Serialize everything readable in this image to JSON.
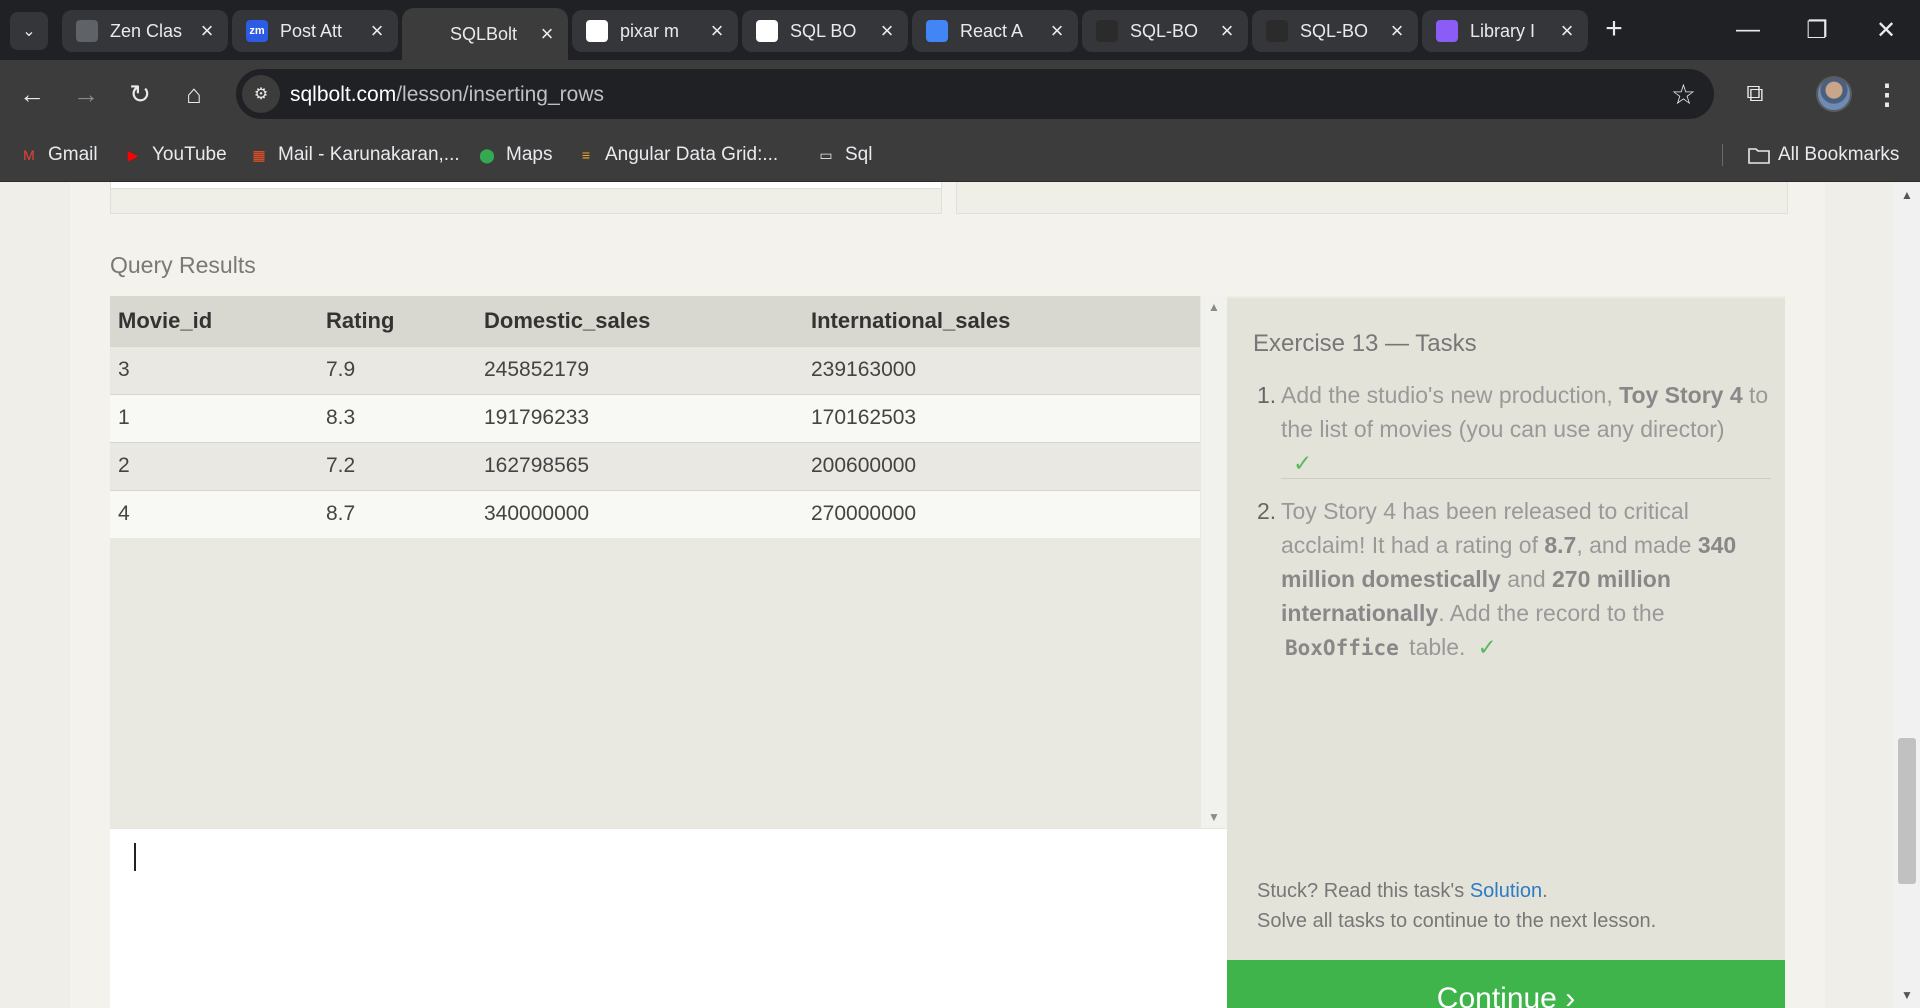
{
  "browser": {
    "tabs": [
      {
        "title": "Zen Clas",
        "icon": "page-icon",
        "icon_color": "#5f6368"
      },
      {
        "title": "Post Att",
        "icon": "zoom-icon",
        "icon_color": "#2d5be3",
        "icon_text": "zm"
      },
      {
        "title": "SQLBolt",
        "icon": "database-icon",
        "icon_color": "#3c3c3c",
        "active": true
      },
      {
        "title": "pixar m",
        "icon": "google-icon",
        "icon_color": "#ffffff"
      },
      {
        "title": "SQL BO",
        "icon": "medium-icon",
        "icon_color": "#ffffff"
      },
      {
        "title": "React A",
        "icon": "docs-icon",
        "icon_color": "#4285f4"
      },
      {
        "title": "SQL-BO",
        "icon": "github-icon",
        "icon_color": "#2b2b2b"
      },
      {
        "title": "SQL-BO",
        "icon": "github-icon",
        "icon_color": "#2b2b2b"
      },
      {
        "title": "Library I",
        "icon": "vite-icon",
        "icon_color": "#8b5cf6"
      }
    ],
    "url_domain": "sqlbolt.com",
    "url_path": "/lesson/inserting_rows",
    "bookmarks": [
      {
        "label": "Gmail",
        "icon": "gmail-icon"
      },
      {
        "label": "YouTube",
        "icon": "youtube-icon"
      },
      {
        "label": "Mail - Karunakaran,...",
        "icon": "microsoft-icon"
      },
      {
        "label": "Maps",
        "icon": "maps-icon"
      },
      {
        "label": "Angular Data Grid:...",
        "icon": "ag-grid-icon"
      },
      {
        "label": "Sql",
        "icon": "folder-icon"
      }
    ],
    "all_bookmarks": "All Bookmarks"
  },
  "results": {
    "title": "Query Results",
    "columns": [
      "Movie_id",
      "Rating",
      "Domestic_sales",
      "International_sales"
    ],
    "rows": [
      [
        "3",
        "7.9",
        "245852179",
        "239163000"
      ],
      [
        "1",
        "8.3",
        "191796233",
        "170162503"
      ],
      [
        "2",
        "7.2",
        "162798565",
        "200600000"
      ],
      [
        "4",
        "8.7",
        "340000000",
        "270000000"
      ]
    ]
  },
  "tasks": {
    "title": "Exercise 13 — Tasks",
    "t1_num": "1.",
    "t1_a": "Add the studio's new production, ",
    "t1_b": "Toy Story 4",
    "t1_c": " to the list of movies (you can use any director)",
    "t2_num": "2.",
    "t2_a": "Toy Story 4 has been released to critical acclaim! It had a rating of ",
    "t2_b": "8.7",
    "t2_c": ", and made ",
    "t2_d": "340 million domestically",
    "t2_e": " and ",
    "t2_f": "270 million internationally",
    "t2_g": ". Add the record to the ",
    "t2_code": "BoxOffice",
    "t2_h": " table.",
    "check": "✓",
    "stuck_a": "Stuck? Read this task's ",
    "stuck_link": "Solution",
    "stuck_b": ".",
    "solve_all": "Solve all tasks to continue to the next lesson.",
    "continue": "Continue ›"
  },
  "colors": {
    "continue": "#3fb44a",
    "check": "#5cb85c",
    "link": "#2d7bc4"
  }
}
